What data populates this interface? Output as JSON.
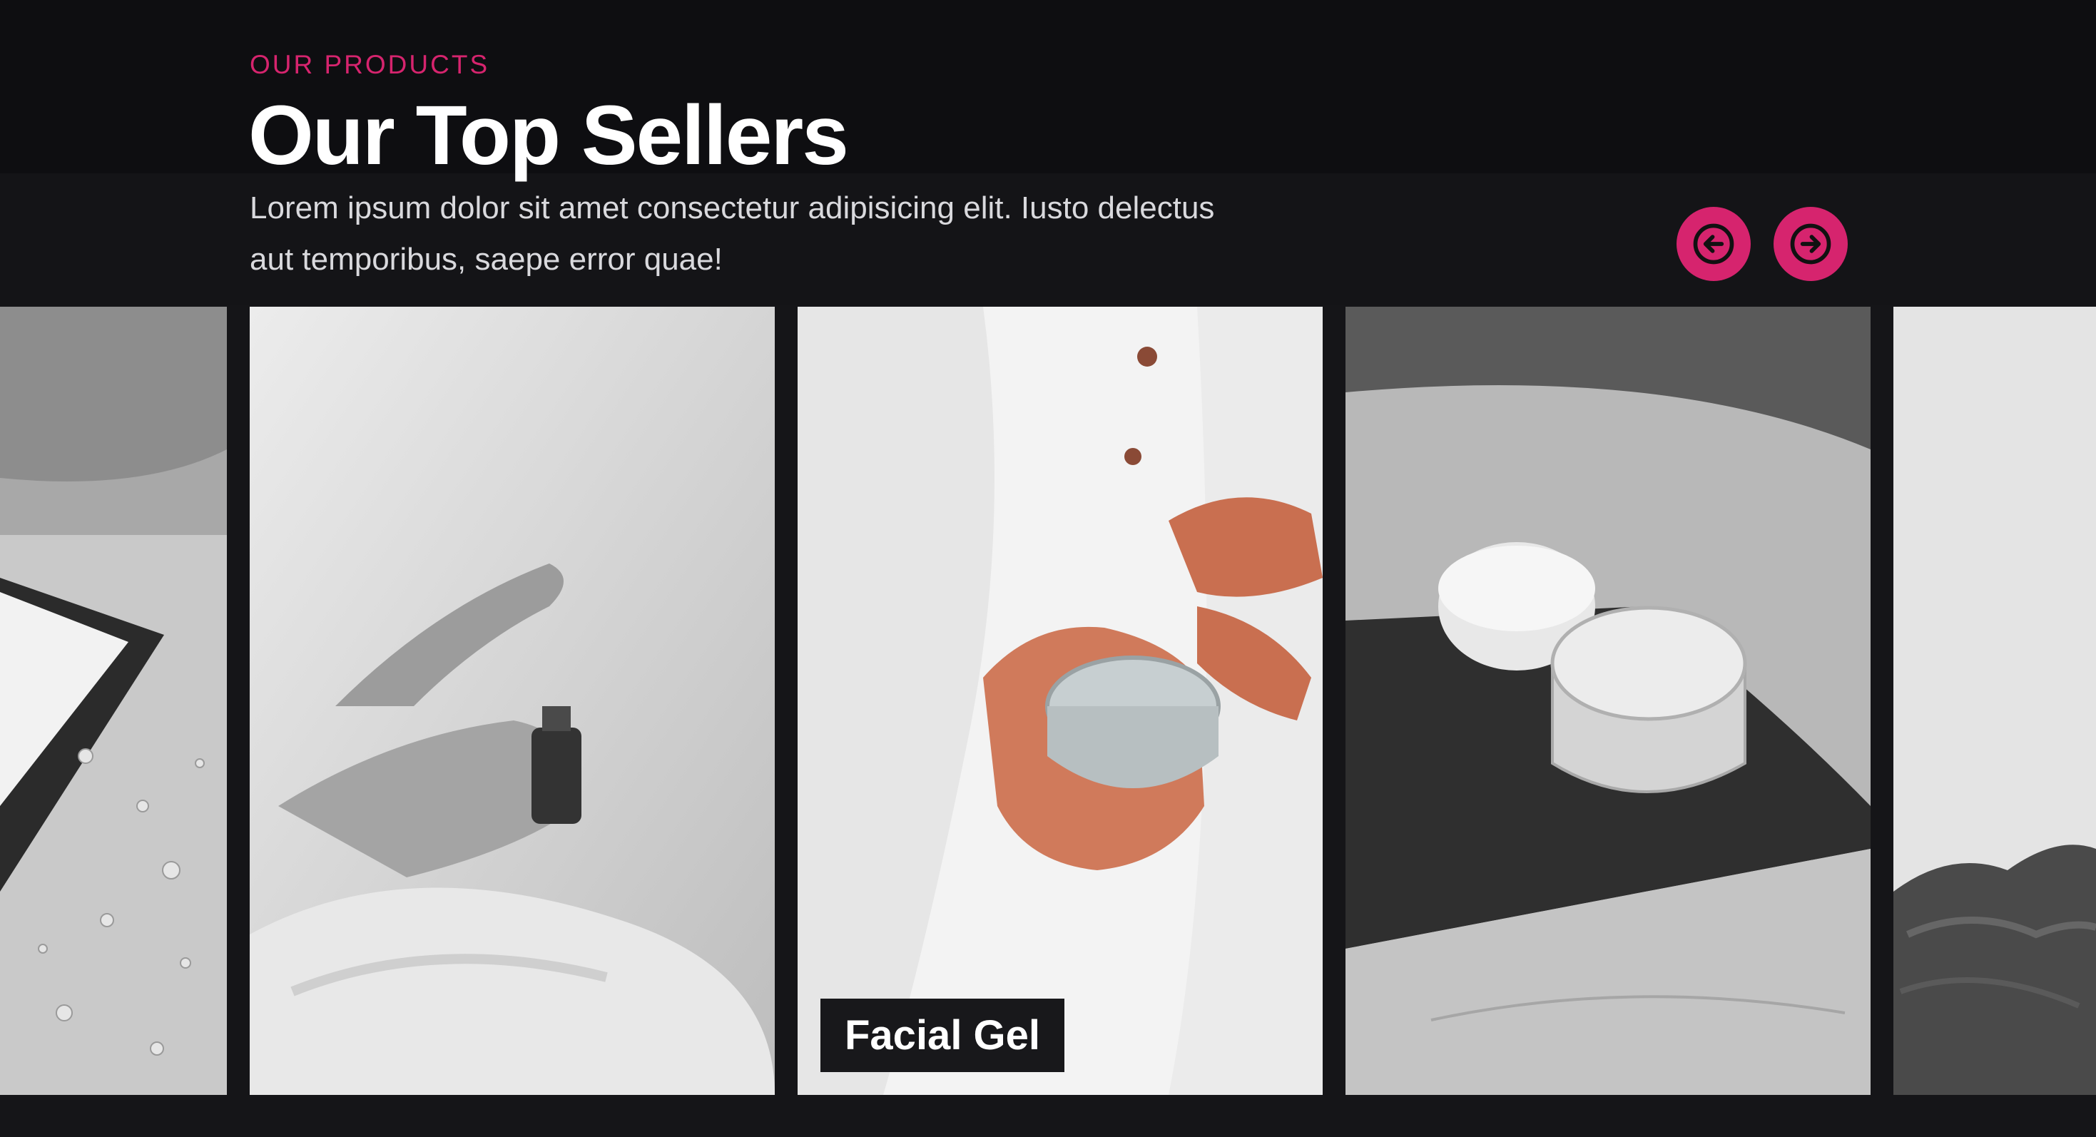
{
  "header": {
    "eyebrow": "OUR PRODUCTS",
    "title": "Our Top Sellers",
    "description": "Lorem ipsum dolor sit amet consectetur adipisicing elit. Iusto delectus aut temporibus, saepe error quae!"
  },
  "navigation": {
    "prev_icon": "arrow-left-circle-icon",
    "next_icon": "arrow-right-circle-icon"
  },
  "products": [
    {
      "label": ""
    },
    {
      "label": ""
    },
    {
      "label": "Facial Gel"
    },
    {
      "label": ""
    },
    {
      "label": ""
    }
  ],
  "colors": {
    "accent": "#d6246e",
    "background": "#151518",
    "label_background": "#18181b",
    "text": "#ffffff"
  }
}
